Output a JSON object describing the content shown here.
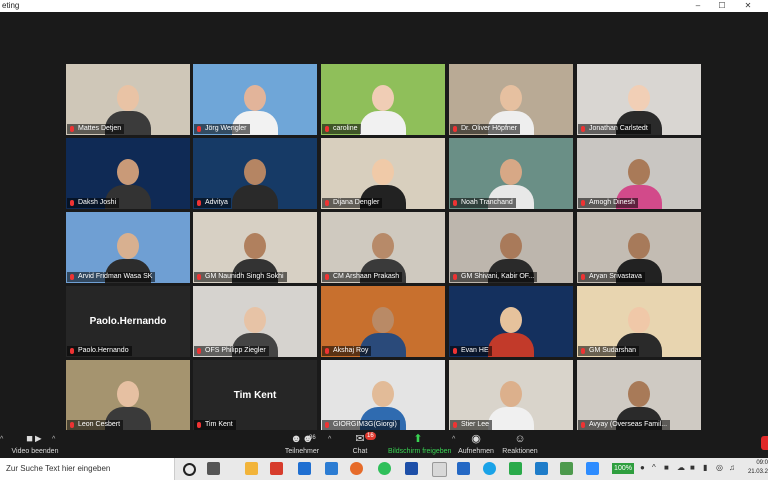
{
  "window": {
    "title": "eting",
    "minimize_icon": "–",
    "maximize_icon": "☐",
    "close_icon": "✕"
  },
  "participants": [
    {
      "name": "Mattes Detjen",
      "scene": "#cfc7b8",
      "skin": "#e9c3a5",
      "shirt": "#3b3b3b"
    },
    {
      "name": "Jörg Wengler",
      "scene": "#6fa6d8",
      "skin": "#e2b49a",
      "shirt": "#f2f2f2",
      "active": true
    },
    {
      "name": "caroline",
      "scene": "#8fbf5a",
      "skin": "#f0cdb5",
      "shirt": "#f1f1f1"
    },
    {
      "name": "Dr. Oliver Höpfner",
      "scene": "#b9aa95",
      "skin": "#e6c0a0",
      "shirt": "#eeeeee"
    },
    {
      "name": "Jonathan Carlstedt",
      "scene": "#d9d6d2",
      "skin": "#f1cfb6",
      "shirt": "#2a2a2a"
    },
    {
      "name": "Daksh Joshi",
      "scene": "#0f2a55",
      "skin": "#c99a78",
      "shirt": "#333333"
    },
    {
      "name": "Advitya",
      "scene": "#163a66",
      "skin": "#b58563",
      "shirt": "#2a2a2a"
    },
    {
      "name": "Dijana Dengler",
      "scene": "#d8cfbe",
      "skin": "#f0caa8",
      "shirt": "#222222"
    },
    {
      "name": "Noah Tranchand",
      "scene": "#6a8f86",
      "skin": "#d7a886",
      "shirt": "#e8e8e8"
    },
    {
      "name": "Amogh Dinesh",
      "scene": "#c9c6c2",
      "skin": "#a97a58",
      "shirt": "#d24a8a"
    },
    {
      "name": "Arvid Fridman Wasa SK",
      "scene": "#6f9fd3",
      "skin": "#d8b090",
      "shirt": "#2c2c2c"
    },
    {
      "name": "GM Naunidh Singh Sokhi",
      "scene": "#d7d0c4",
      "skin": "#b0805e",
      "shirt": "#333333"
    },
    {
      "name": "CM Arshaan Prakash",
      "scene": "#cfc9bf",
      "skin": "#b78a69",
      "shirt": "#3a3a3a"
    },
    {
      "name": "GM Shivani, Kabir OF...",
      "scene": "#bdb6ad",
      "skin": "#a97a5a",
      "shirt": "#2a2a2a"
    },
    {
      "name": "Aryan Srivastava",
      "scene": "#c3bcb3",
      "skin": "#a77a5a",
      "shirt": "#222222"
    },
    {
      "name": "Paolo.Hernando",
      "video": false
    },
    {
      "name": "OFS Philipp Ziegler",
      "scene": "#d6d3cf",
      "skin": "#e7c3a6",
      "shirt": "#444444"
    },
    {
      "name": "Akshaj Roy",
      "scene": "#c8702e",
      "skin": "#b98a66",
      "shirt": "#2a4a7a"
    },
    {
      "name": "Evan HE",
      "scene": "#14305e",
      "skin": "#e6c29c",
      "shirt": "#c23a2a"
    },
    {
      "name": "GM Sudarshan",
      "scene": "#e8d5b0",
      "skin": "#f0c8a8",
      "shirt": "#2a2a2a"
    },
    {
      "name": "Leon Cesbert",
      "scene": "#a5946f",
      "skin": "#e6c0a2",
      "shirt": "#3a3a3a"
    },
    {
      "name": "Tim Kent",
      "video": false
    },
    {
      "name": "GIORGIM3G(Giorgi)",
      "scene": "#e4e4e4",
      "skin": "#e2bb98",
      "shirt": "#2f6bb0"
    },
    {
      "name": "Stier Lee",
      "scene": "#d9d4cb",
      "skin": "#dcb08c",
      "shirt": "#f0f0f0"
    },
    {
      "name": "Avyay (Overseas Famil...",
      "scene": "#cfcac3",
      "skin": "#a87a58",
      "shirt": "#2a2a2a"
    }
  ],
  "toolbar": {
    "stop_video_label": "Video beenden",
    "participants_label": "Teilnehmer",
    "participants_count": "86",
    "chat_label": "Chat",
    "chat_badge": "16",
    "share_label": "Bildschirm freigeben",
    "record_label": "Aufnehmen",
    "reactions_label": "Reaktionen",
    "accent_color": "#39d353"
  },
  "taskbar": {
    "search_placeholder": "Zur Suche Text hier eingeben",
    "battery": "100%",
    "time": "09:0",
    "date": "21.03.2"
  }
}
